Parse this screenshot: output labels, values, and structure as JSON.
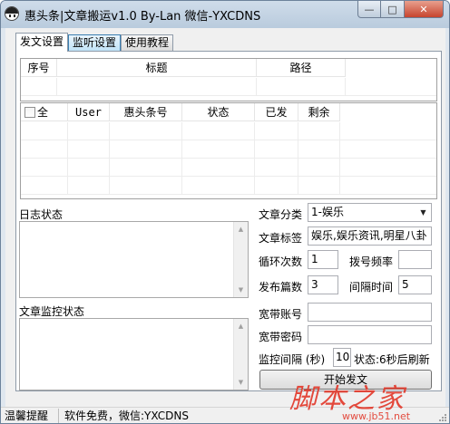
{
  "window": {
    "title": "惠头条|文章搬运v1.0 By-Lan 微信-YXCDNS"
  },
  "tabs": [
    {
      "label": "发文设置",
      "active": true
    },
    {
      "label": "监听设置",
      "active": false
    },
    {
      "label": "使用教程",
      "active": false
    }
  ],
  "title_grid": {
    "columns": [
      "序号",
      "标题",
      "路径"
    ]
  },
  "account_grid": {
    "columns": [
      "全",
      "User",
      "惠头条号",
      "状态",
      "已发",
      "剩余"
    ]
  },
  "log": {
    "label": "日志状态"
  },
  "monitor_log": {
    "label": "文章监控状态"
  },
  "settings": {
    "category_label": "文章分类",
    "category_value": "1-娱乐",
    "tags_label": "文章标签",
    "tags_value": "娱乐,娱乐资讯,明星八卦",
    "loop_label": "循环次数",
    "loop_value": "1",
    "dial_label": "拨号频率",
    "dial_value": "",
    "posts_label": "发布篇数",
    "posts_value": "3",
    "interval_label": "间隔时间",
    "interval_value": "5",
    "broadband_account_label": "宽带账号",
    "broadband_account_value": "",
    "broadband_password_label": "宽带密码",
    "broadband_password_value": "",
    "monitor_interval_label": "监控间隔 (秒)",
    "monitor_interval_value": "10",
    "monitor_status": "状态:6秒后刷新",
    "start_button": "开始发文"
  },
  "statusbar": {
    "pane1": "温馨提醒",
    "pane2": "软件免费，微信:YXCDNS"
  },
  "watermark": {
    "logo": "脚本之家",
    "url": "www.jb51.net"
  },
  "colors": {
    "title_gradient_top": "#cfdcea",
    "close_button": "#c7442e",
    "active_tab_hover": "#3c7fb1",
    "watermark": "#e23a2c"
  }
}
